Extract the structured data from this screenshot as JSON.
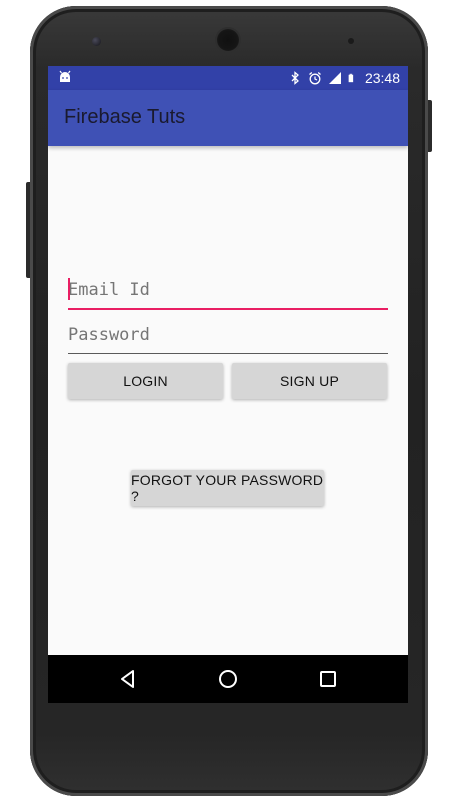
{
  "status_bar": {
    "time": "23:48",
    "icons": [
      "android-app-icon",
      "bluetooth-icon",
      "alarm-icon",
      "signal-icon",
      "battery-icon"
    ],
    "color": "#3241a8"
  },
  "app_bar": {
    "title": "Firebase Tuts",
    "color": "#3f51b5"
  },
  "form": {
    "email_placeholder": "Email Id",
    "password_placeholder": "Password",
    "accent_color": "#e91e63"
  },
  "buttons": {
    "login": "LOGIN",
    "signup": "SIGN UP",
    "forgot": "FORGOT YOUR PASSWORD ?"
  },
  "nav_bar": {
    "icons": [
      "back-icon",
      "home-icon",
      "recents-icon"
    ]
  }
}
